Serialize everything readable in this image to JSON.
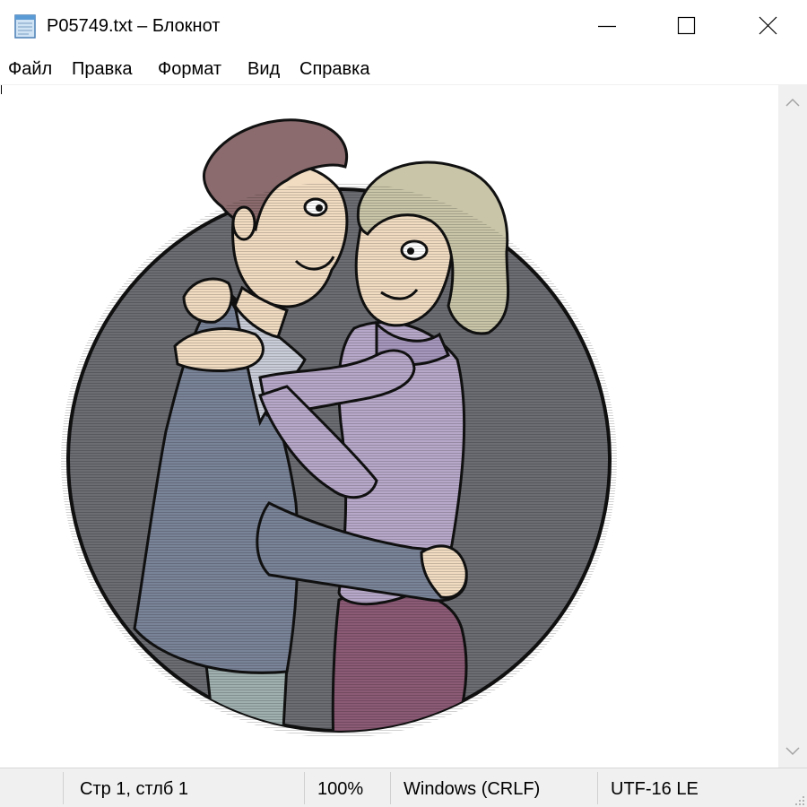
{
  "window": {
    "title": "P05749.txt – Блокнот",
    "icon": "notepad-icon",
    "buttons": {
      "minimize": "minimize-icon",
      "maximize": "maximize-icon",
      "close": "close-icon"
    }
  },
  "menu": {
    "file": "Файл",
    "edit": "Правка",
    "format": "Формат",
    "view": "Вид",
    "help": "Справка"
  },
  "editor": {
    "content": "ascii-art-picture",
    "picture_subject": "cartoon couple embracing inside a dark circle"
  },
  "status": {
    "position": "Стр 1, стлб 1",
    "zoom": "100%",
    "line_endings": "Windows (CRLF)",
    "encoding": "UTF-16 LE"
  },
  "colors": {
    "circle": "#6b6d73",
    "jacket": "#7a8498",
    "sweater": "#b7a8c9",
    "skirt": "#8b5a75",
    "skin": "#f1dcc2",
    "man_hair": "#8b6b6d",
    "woman_hair": "#c8c5a8",
    "statusbar_bg": "#f0f0f0"
  }
}
